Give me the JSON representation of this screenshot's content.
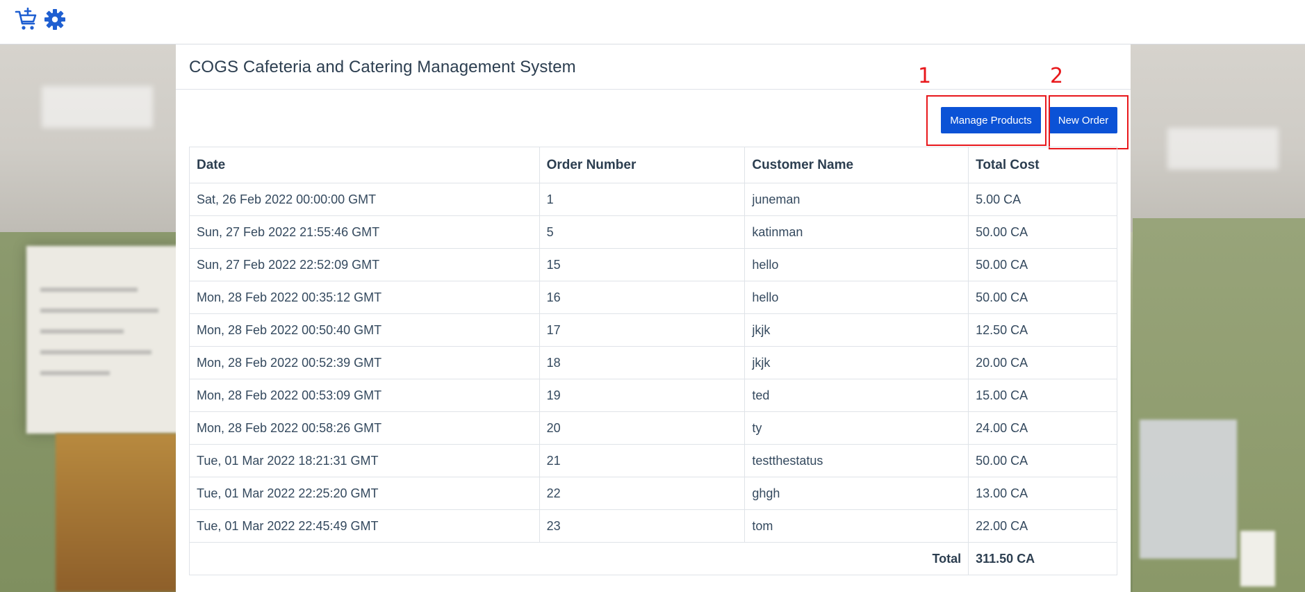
{
  "topbar": {
    "cart_icon": "cart-add-icon",
    "settings_icon": "gear-icon",
    "accent": "#1f5fd1"
  },
  "header": {
    "title": "COGS Cafeteria and Catering Management System"
  },
  "actions": {
    "manage_products_label": "Manage Products",
    "new_order_label": "New Order",
    "button_color": "#0b52d6"
  },
  "annotations": {
    "one": "1",
    "two": "2",
    "color": "#e8171b"
  },
  "table": {
    "headers": [
      "Date",
      "Order Number",
      "Customer Name",
      "Total Cost"
    ],
    "rows": [
      [
        "Sat, 26 Feb 2022 00:00:00 GMT",
        "1",
        "juneman",
        "5.00 CA"
      ],
      [
        "Sun, 27 Feb 2022 21:55:46 GMT",
        "5",
        "katinman",
        "50.00 CA"
      ],
      [
        "Sun, 27 Feb 2022 22:52:09 GMT",
        "15",
        "hello",
        "50.00 CA"
      ],
      [
        "Mon, 28 Feb 2022 00:35:12 GMT",
        "16",
        "hello",
        "50.00 CA"
      ],
      [
        "Mon, 28 Feb 2022 00:50:40 GMT",
        "17",
        "jkjk",
        "12.50 CA"
      ],
      [
        "Mon, 28 Feb 2022 00:52:39 GMT",
        "18",
        "jkjk",
        "20.00 CA"
      ],
      [
        "Mon, 28 Feb 2022 00:53:09 GMT",
        "19",
        "ted",
        "15.00 CA"
      ],
      [
        "Mon, 28 Feb 2022 00:58:26 GMT",
        "20",
        "ty",
        "24.00 CA"
      ],
      [
        "Tue, 01 Mar 2022 18:21:31 GMT",
        "21",
        "testthestatus",
        "50.00 CA"
      ],
      [
        "Tue, 01 Mar 2022 22:25:20 GMT",
        "22",
        "ghgh",
        "13.00 CA"
      ],
      [
        "Tue, 01 Mar 2022 22:45:49 GMT",
        "23",
        "tom",
        "22.00 CA"
      ]
    ],
    "total_label": "Total",
    "total_value": "311.50 CA"
  }
}
